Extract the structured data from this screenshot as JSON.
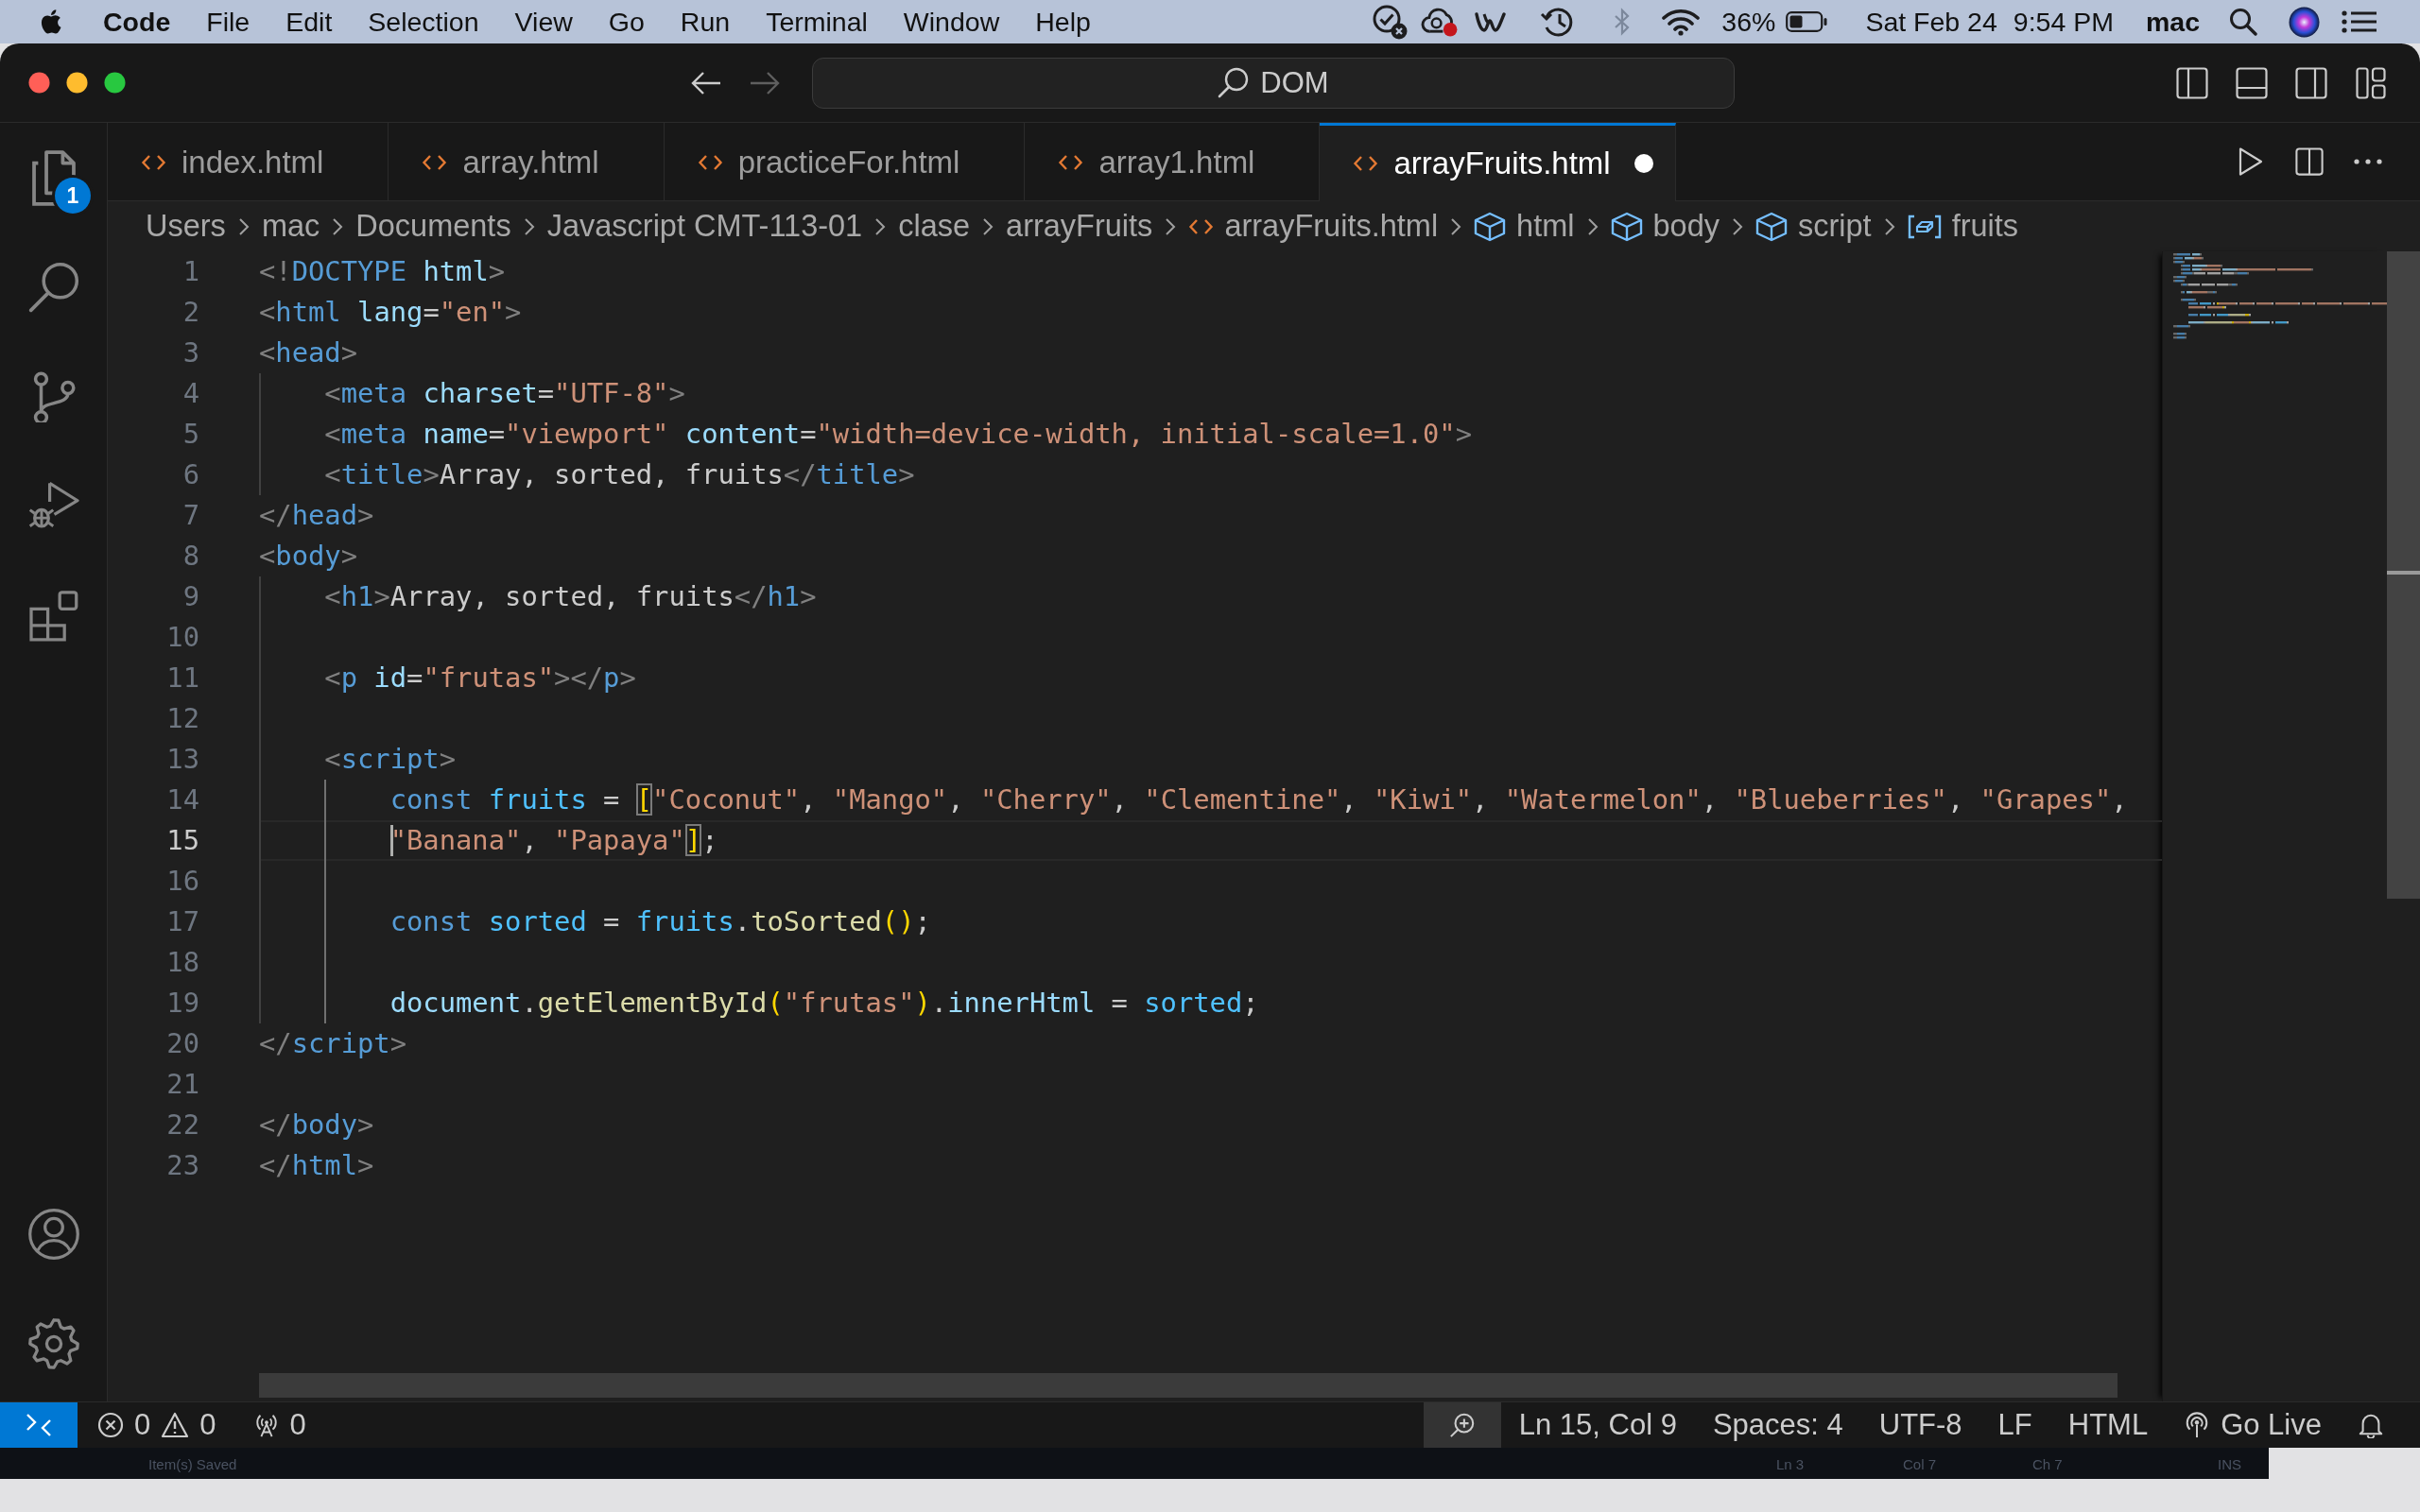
{
  "menu_bar": {
    "app_name": "Code",
    "items": [
      "File",
      "Edit",
      "Selection",
      "View",
      "Go",
      "Run",
      "Terminal",
      "Window",
      "Help"
    ],
    "battery": "36%",
    "date": "Sat Feb 24",
    "time": "9:54 PM",
    "user": "mac"
  },
  "title_bar": {
    "command_center": "DOM"
  },
  "activity_bar": {
    "explorer_badge": "1"
  },
  "tabs": [
    {
      "label": "index.html",
      "selected": false,
      "modified": false
    },
    {
      "label": "array.html",
      "selected": false,
      "modified": false
    },
    {
      "label": "practiceFor.html",
      "selected": false,
      "modified": false
    },
    {
      "label": "array1.html",
      "selected": false,
      "modified": false
    },
    {
      "label": "arrayFruits.html",
      "selected": true,
      "modified": true
    }
  ],
  "breadcrumbs": [
    {
      "label": "Users",
      "kind": "folder"
    },
    {
      "label": "mac",
      "kind": "folder"
    },
    {
      "label": "Documents",
      "kind": "folder"
    },
    {
      "label": "Javascript CMT-113-01",
      "kind": "folder"
    },
    {
      "label": "clase",
      "kind": "folder"
    },
    {
      "label": "arrayFruits",
      "kind": "folder"
    },
    {
      "label": "arrayFruits.html",
      "kind": "file"
    },
    {
      "label": "html",
      "kind": "element"
    },
    {
      "label": "body",
      "kind": "element"
    },
    {
      "label": "script",
      "kind": "element"
    },
    {
      "label": "fruits",
      "kind": "variable"
    }
  ],
  "editor": {
    "lines": [
      {
        "number": "1",
        "current": false,
        "tokens": [
          {
            "text": "<!",
            "kind": "punct"
          },
          {
            "text": "DOCTYPE",
            "kind": "tag"
          },
          {
            "text": " html",
            "kind": "attr"
          },
          {
            "text": ">",
            "kind": "punct"
          }
        ]
      },
      {
        "number": "2",
        "current": false,
        "tokens": [
          {
            "text": "<",
            "kind": "punct"
          },
          {
            "text": "html",
            "kind": "tag"
          },
          {
            "text": " lang",
            "kind": "attr"
          },
          {
            "text": "=",
            "kind": "text"
          },
          {
            "text": "\"en\"",
            "kind": "string"
          },
          {
            "text": ">",
            "kind": "punct"
          }
        ]
      },
      {
        "number": "3",
        "current": false,
        "tokens": [
          {
            "text": "<",
            "kind": "punct"
          },
          {
            "text": "head",
            "kind": "tag"
          },
          {
            "text": ">",
            "kind": "punct"
          }
        ]
      },
      {
        "number": "4",
        "current": false,
        "tokens": [
          {
            "text": "    <",
            "kind": "punct"
          },
          {
            "text": "meta",
            "kind": "tag"
          },
          {
            "text": " charset",
            "kind": "attr"
          },
          {
            "text": "=",
            "kind": "text"
          },
          {
            "text": "\"UTF-8\"",
            "kind": "string"
          },
          {
            "text": ">",
            "kind": "punct"
          }
        ]
      },
      {
        "number": "5",
        "current": false,
        "tokens": [
          {
            "text": "    <",
            "kind": "punct"
          },
          {
            "text": "meta",
            "kind": "tag"
          },
          {
            "text": " name",
            "kind": "attr"
          },
          {
            "text": "=",
            "kind": "text"
          },
          {
            "text": "\"viewport\"",
            "kind": "string"
          },
          {
            "text": " content",
            "kind": "attr"
          },
          {
            "text": "=",
            "kind": "text"
          },
          {
            "text": "\"width=device-width, initial-scale=1.0\"",
            "kind": "string"
          },
          {
            "text": ">",
            "kind": "punct"
          }
        ]
      },
      {
        "number": "6",
        "current": false,
        "tokens": [
          {
            "text": "    <",
            "kind": "punct"
          },
          {
            "text": "title",
            "kind": "tag"
          },
          {
            "text": ">",
            "kind": "punct"
          },
          {
            "text": "Array, sorted, fruits",
            "kind": "text"
          },
          {
            "text": "</",
            "kind": "punct"
          },
          {
            "text": "title",
            "kind": "tag"
          },
          {
            "text": ">",
            "kind": "punct"
          }
        ]
      },
      {
        "number": "7",
        "current": false,
        "tokens": [
          {
            "text": "</",
            "kind": "punct"
          },
          {
            "text": "head",
            "kind": "tag"
          },
          {
            "text": ">",
            "kind": "punct"
          }
        ]
      },
      {
        "number": "8",
        "current": false,
        "tokens": [
          {
            "text": "<",
            "kind": "punct"
          },
          {
            "text": "body",
            "kind": "tag"
          },
          {
            "text": ">",
            "kind": "punct"
          }
        ]
      },
      {
        "number": "9",
        "current": false,
        "tokens": [
          {
            "text": "    <",
            "kind": "punct"
          },
          {
            "text": "h1",
            "kind": "tag"
          },
          {
            "text": ">",
            "kind": "punct"
          },
          {
            "text": "Array, sorted, fruits",
            "kind": "text"
          },
          {
            "text": "</",
            "kind": "punct"
          },
          {
            "text": "h1",
            "kind": "tag"
          },
          {
            "text": ">",
            "kind": "punct"
          }
        ]
      },
      {
        "number": "10",
        "current": false
      },
      {
        "number": "11",
        "current": false,
        "tokens": [
          {
            "text": "    <",
            "kind": "punct"
          },
          {
            "text": "p",
            "kind": "tag"
          },
          {
            "text": " id",
            "kind": "attr"
          },
          {
            "text": "=",
            "kind": "text"
          },
          {
            "text": "\"frutas\"",
            "kind": "string"
          },
          {
            "text": "></",
            "kind": "punct"
          },
          {
            "text": "p",
            "kind": "tag"
          },
          {
            "text": ">",
            "kind": "punct"
          }
        ]
      },
      {
        "number": "12",
        "current": false
      },
      {
        "number": "13",
        "current": false,
        "tokens": [
          {
            "text": "    <",
            "kind": "punct"
          },
          {
            "text": "script",
            "kind": "tag"
          },
          {
            "text": ">",
            "kind": "punct"
          }
        ]
      },
      {
        "number": "14",
        "current": false,
        "tokens": [
          {
            "text": "        const",
            "kind": "keyword"
          },
          {
            "text": " fruits",
            "kind": "const"
          },
          {
            "text": " = ",
            "kind": "text"
          },
          {
            "text": "[",
            "kind": "match"
          },
          {
            "text": "\"Coconut\"",
            "kind": "string"
          },
          {
            "text": ", ",
            "kind": "text"
          },
          {
            "text": "\"Mango\"",
            "kind": "string"
          },
          {
            "text": ", ",
            "kind": "text"
          },
          {
            "text": "\"Cherry\"",
            "kind": "string"
          },
          {
            "text": ", ",
            "kind": "text"
          },
          {
            "text": "\"Clementine\"",
            "kind": "string"
          },
          {
            "text": ", ",
            "kind": "text"
          },
          {
            "text": "\"Kiwi\"",
            "kind": "string"
          },
          {
            "text": ", ",
            "kind": "text"
          },
          {
            "text": "\"Watermelon\"",
            "kind": "string"
          },
          {
            "text": ", ",
            "kind": "text"
          },
          {
            "text": "\"Blueberries\"",
            "kind": "string"
          },
          {
            "text": ", ",
            "kind": "text"
          },
          {
            "text": "\"Grapes\"",
            "kind": "string"
          },
          {
            "text": ",",
            "kind": "text"
          }
        ]
      },
      {
        "number": "15",
        "current": true,
        "tokens": [
          {
            "text": "        \"Banana\"",
            "kind": "string"
          },
          {
            "text": ", ",
            "kind": "text"
          },
          {
            "text": "\"Papaya\"",
            "kind": "string"
          },
          {
            "text": "]",
            "kind": "match"
          },
          {
            "text": ";",
            "kind": "text"
          }
        ]
      },
      {
        "number": "16",
        "current": false
      },
      {
        "number": "17",
        "current": false,
        "tokens": [
          {
            "text": "        const",
            "kind": "keyword"
          },
          {
            "text": " sorted",
            "kind": "const"
          },
          {
            "text": " = ",
            "kind": "text"
          },
          {
            "text": "fruits",
            "kind": "const"
          },
          {
            "text": ".",
            "kind": "text"
          },
          {
            "text": "toSorted",
            "kind": "func"
          },
          {
            "text": "()",
            "kind": "bracket"
          },
          {
            "text": ";",
            "kind": "text"
          }
        ]
      },
      {
        "number": "18",
        "current": false
      },
      {
        "number": "19",
        "current": false,
        "tokens": [
          {
            "text": "        document",
            "kind": "var"
          },
          {
            "text": ".",
            "kind": "text"
          },
          {
            "text": "getElementById",
            "kind": "func"
          },
          {
            "text": "(",
            "kind": "bracket"
          },
          {
            "text": "\"frutas\"",
            "kind": "string"
          },
          {
            "text": ")",
            "kind": "bracket"
          },
          {
            "text": ".",
            "kind": "text"
          },
          {
            "text": "innerHtml",
            "kind": "var"
          },
          {
            "text": " = ",
            "kind": "text"
          },
          {
            "text": "sorted",
            "kind": "const"
          },
          {
            "text": ";",
            "kind": "text"
          }
        ]
      },
      {
        "number": "20",
        "current": false,
        "tokens": [
          {
            "text": "</",
            "kind": "punct"
          },
          {
            "text": "script",
            "kind": "tag"
          },
          {
            "text": ">",
            "kind": "punct"
          }
        ]
      },
      {
        "number": "21",
        "current": false
      },
      {
        "number": "22",
        "current": false,
        "tokens": [
          {
            "text": "</",
            "kind": "punct"
          },
          {
            "text": "body",
            "kind": "tag"
          },
          {
            "text": ">",
            "kind": "punct"
          }
        ]
      },
      {
        "number": "23",
        "current": false,
        "tokens": [
          {
            "text": "</",
            "kind": "punct"
          },
          {
            "text": "html",
            "kind": "tag"
          },
          {
            "text": ">",
            "kind": "punct"
          }
        ]
      }
    ]
  },
  "status_bar": {
    "errors": "0",
    "warnings": "0",
    "ports": "0",
    "position": "Ln 15, Col 9",
    "indentation": "Spaces: 4",
    "encoding": "UTF-8",
    "line_ending": "LF",
    "language": "HTML",
    "live_server": "Go Live"
  },
  "background_window": {
    "status_message": "Item(s) Saved",
    "status_items": [
      "Ln 3",
      "Col 7",
      "Ch 7",
      "INS"
    ]
  }
}
